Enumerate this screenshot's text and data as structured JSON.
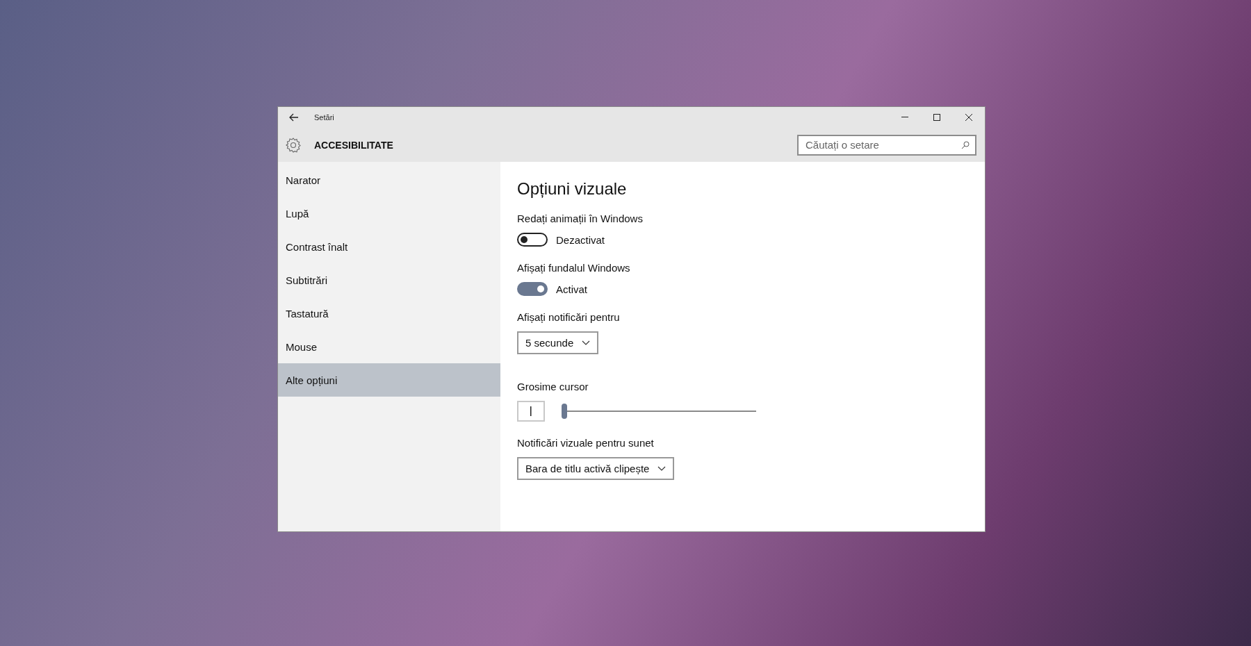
{
  "window": {
    "title": "Setări"
  },
  "header": {
    "title": "ACCESIBILITATE",
    "search": {
      "placeholder": "Căutați o setare"
    }
  },
  "sidebar": {
    "items": [
      {
        "label": "Narator",
        "selected": false
      },
      {
        "label": "Lupă",
        "selected": false
      },
      {
        "label": "Contrast înalt",
        "selected": false
      },
      {
        "label": "Subtitrări",
        "selected": false
      },
      {
        "label": "Tastatură",
        "selected": false
      },
      {
        "label": "Mouse",
        "selected": false
      },
      {
        "label": "Alte opțiuni",
        "selected": true
      }
    ]
  },
  "content": {
    "title": "Opțiuni vizuale",
    "settings": [
      {
        "kind": "toggle",
        "label": "Redați animații în Windows",
        "on": false,
        "state_text": "Dezactivat"
      },
      {
        "kind": "toggle",
        "label": "Afișați fundalul Windows",
        "on": true,
        "state_text": "Activat"
      },
      {
        "kind": "dropdown",
        "label": "Afișați notificări pentru",
        "value": "5 secunde"
      },
      {
        "kind": "slider",
        "label": "Grosime cursor",
        "level": 0
      },
      {
        "kind": "dropdown",
        "label": "Notificări vizuale pentru sunet",
        "value": "Bara de titlu activă clipește"
      }
    ]
  }
}
